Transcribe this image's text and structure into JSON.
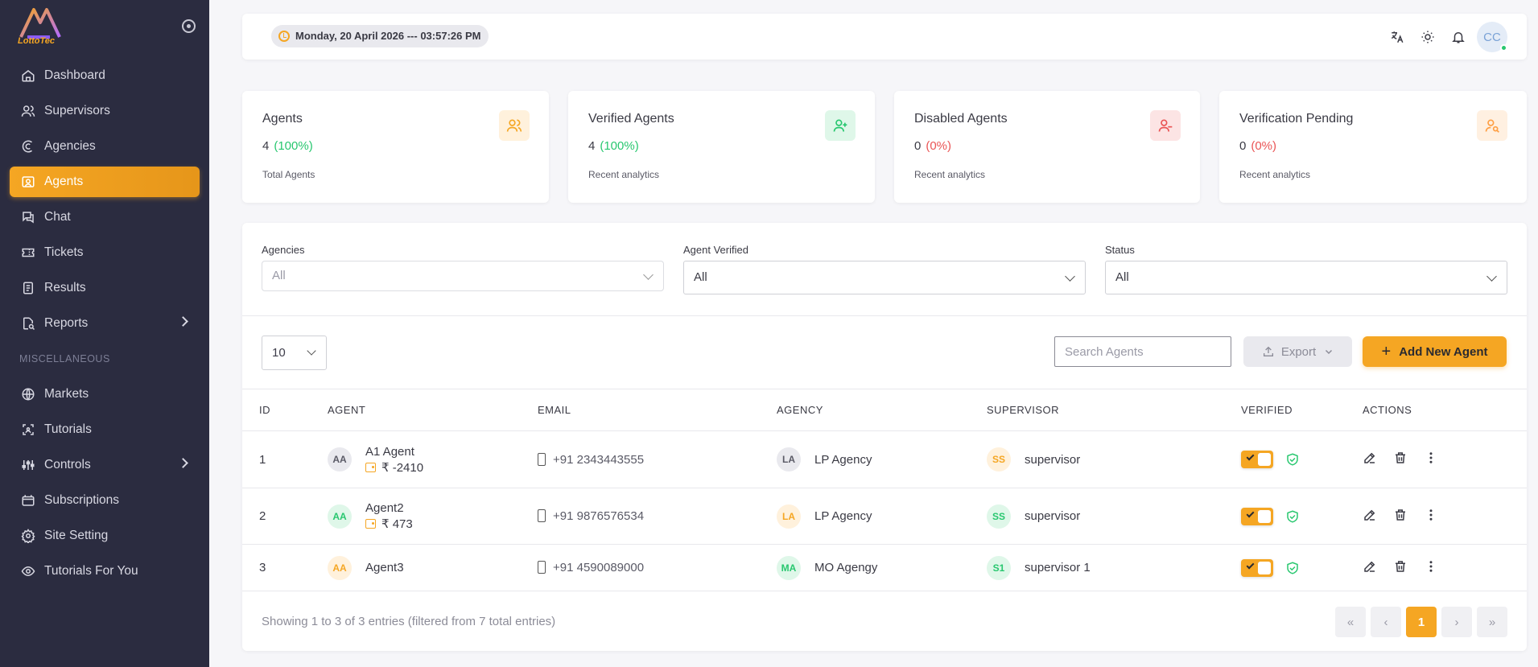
{
  "brand": {
    "logo_text": "LottoTec"
  },
  "sidebar": {
    "items": [
      {
        "label": "Dashboard",
        "icon": "home-icon"
      },
      {
        "label": "Supervisors",
        "icon": "users-icon"
      },
      {
        "label": "Agencies",
        "icon": "agency-icon"
      },
      {
        "label": "Agents",
        "icon": "agent-icon",
        "active": true
      },
      {
        "label": "Chat",
        "icon": "chat-icon"
      },
      {
        "label": "Tickets",
        "icon": "ticket-icon"
      },
      {
        "label": "Results",
        "icon": "results-icon"
      },
      {
        "label": "Reports",
        "icon": "report-icon",
        "has_submenu": true
      }
    ],
    "section_label": "MISCELLANEOUS",
    "misc_items": [
      {
        "label": "Markets",
        "icon": "globe-icon"
      },
      {
        "label": "Tutorials",
        "icon": "tutorial-icon"
      },
      {
        "label": "Controls",
        "icon": "sliders-icon",
        "has_submenu": true
      },
      {
        "label": "Subscriptions",
        "icon": "subscription-icon"
      },
      {
        "label": "Site Setting",
        "icon": "gear-icon"
      },
      {
        "label": "Tutorials For You",
        "icon": "eye-icon"
      }
    ]
  },
  "topbar": {
    "datetime": "Monday, 20 April 2026 --- 03:57:26 PM",
    "avatar_initials": "CC"
  },
  "stats": [
    {
      "title": "Agents",
      "value": "4",
      "percent": "(100%)",
      "sub": "Total Agents",
      "color": "#f5a623",
      "bg": "#fff1dc"
    },
    {
      "title": "Verified Agents",
      "value": "4",
      "percent": "(100%)",
      "sub": "Recent analytics",
      "color": "#28c76f",
      "bg": "#dff7e9"
    },
    {
      "title": "Disabled Agents",
      "value": "0",
      "percent": "(0%)",
      "sub": "Recent analytics",
      "color": "#ea5455",
      "bg": "#fce4e4"
    },
    {
      "title": "Verification Pending",
      "value": "0",
      "percent": "(0%)",
      "sub": "Recent analytics",
      "color": "#ff9f43",
      "bg": "#fff0e1"
    }
  ],
  "filters": {
    "agencies": {
      "label": "Agencies",
      "value": "All"
    },
    "verified": {
      "label": "Agent Verified",
      "value": "All"
    },
    "status": {
      "label": "Status",
      "value": "All"
    }
  },
  "toolbar": {
    "page_size": "10",
    "search_placeholder": "Search Agents",
    "export_label": "Export",
    "add_label": "Add New Agent"
  },
  "table": {
    "headers": [
      "ID",
      "AGENT",
      "EMAIL",
      "AGENCY",
      "SUPERVISOR",
      "VERIFIED",
      "ACTIONS"
    ],
    "rows": [
      {
        "id": "1",
        "agent_initials": "AA",
        "agent_name": "A1 Agent",
        "balance": "₹ -2410",
        "phone": "+91 2343443555",
        "agency_initials": "LA",
        "agency": "LP Agency",
        "supervisor_initials": "SS",
        "supervisor": "supervisor",
        "verified": true,
        "agent_badge": {
          "bg": "#e9e9ee",
          "fg": "#5a5a66"
        },
        "agency_badge": {
          "bg": "#e9e9ee",
          "fg": "#5a5a66"
        },
        "supervisor_badge": {
          "bg": "#fff1dc",
          "fg": "#f5a623"
        }
      },
      {
        "id": "2",
        "agent_initials": "AA",
        "agent_name": "Agent2",
        "balance": "₹ 473",
        "phone": "+91 9876576534",
        "agency_initials": "LA",
        "agency": "LP Agency",
        "supervisor_initials": "SS",
        "supervisor": "supervisor",
        "verified": true,
        "agent_badge": {
          "bg": "#dff7e9",
          "fg": "#28c76f"
        },
        "agency_badge": {
          "bg": "#fff1dc",
          "fg": "#f5a623"
        },
        "supervisor_badge": {
          "bg": "#dff7e9",
          "fg": "#28c76f"
        }
      },
      {
        "id": "3",
        "agent_initials": "AA",
        "agent_name": "Agent3",
        "balance": "",
        "phone": "+91 4590089000",
        "agency_initials": "MA",
        "agency": "MO Agengy",
        "supervisor_initials": "S1",
        "supervisor": "supervisor 1",
        "verified": true,
        "agent_badge": {
          "bg": "#fff1dc",
          "fg": "#f5a623"
        },
        "agency_badge": {
          "bg": "#dff7e9",
          "fg": "#28c76f"
        },
        "supervisor_badge": {
          "bg": "#dff7e9",
          "fg": "#28c76f"
        }
      }
    ]
  },
  "footer": {
    "entries_text": "Showing 1 to 3 of 3 entries (filtered from 7 total entries)",
    "current_page": "1"
  },
  "colors": {
    "accent": "#f5a623",
    "sidebar_bg": "#2b2c40",
    "success": "#28c76f",
    "danger": "#ea5455"
  }
}
